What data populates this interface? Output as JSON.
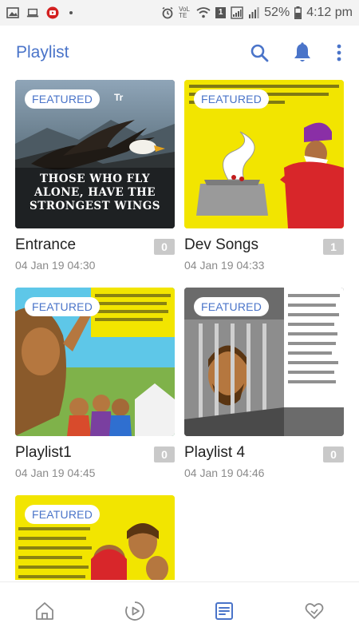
{
  "status_bar": {
    "battery": "52%",
    "time": "4:12 pm",
    "network_label": "VoLTE",
    "sim_number": "1"
  },
  "app_bar": {
    "title": "Playlist",
    "actions": [
      "search-icon",
      "bell-icon",
      "more-vertical-icon"
    ]
  },
  "badge_label": "FEATURED",
  "playlists": [
    {
      "title": "Entrance",
      "count": "0",
      "date": "04 Jan 19 04:30",
      "thumb_caption": "THOSE WHO FLY ALONE, HAVE THE STRONGEST WINGS"
    },
    {
      "title": "Dev Songs",
      "count": "1",
      "date": "04 Jan 19 04:33"
    },
    {
      "title": "Playlist1",
      "count": "0",
      "date": "04 Jan 19 04:45"
    },
    {
      "title": "Playlist 4",
      "count": "0",
      "date": "04 Jan 19 04:46"
    },
    {
      "title": "",
      "count": "",
      "date": ""
    }
  ],
  "bottom_nav": [
    {
      "icon": "home-icon",
      "active": false
    },
    {
      "icon": "play-circle-icon",
      "active": false
    },
    {
      "icon": "playlist-icon",
      "active": true
    },
    {
      "icon": "heart-icon",
      "active": false
    }
  ],
  "colors": {
    "accent": "#4a74c9",
    "count_badge": "#c9c9c9",
    "date_text": "#8a8a8a",
    "yellow_thumb": "#f2e500"
  }
}
